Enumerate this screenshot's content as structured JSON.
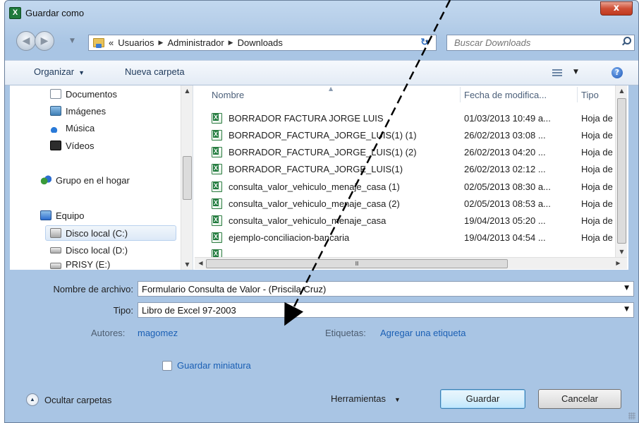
{
  "window": {
    "title": "Guardar como",
    "app_icon_letter": "X",
    "close_glyph": "x"
  },
  "navbar": {
    "crumb_prefix": "«",
    "breadcrumb": [
      "Usuarios",
      "Administrador",
      "Downloads"
    ],
    "search_placeholder": "Buscar Downloads"
  },
  "toolbar": {
    "organize_label": "Organizar",
    "new_folder_label": "Nueva carpeta",
    "help_glyph": "?"
  },
  "nav_pane": {
    "items": [
      {
        "label": "Documentos",
        "icon": "document-icon"
      },
      {
        "label": "Imágenes",
        "icon": "pictures-icon"
      },
      {
        "label": "Música",
        "icon": "music-icon"
      },
      {
        "label": "Vídeos",
        "icon": "video-icon"
      },
      {
        "label": "Grupo en el hogar",
        "icon": "homegroup-icon"
      },
      {
        "label": "Equipo",
        "icon": "computer-icon"
      },
      {
        "label": "Disco local (C:)",
        "icon": "drive-icon",
        "selected": true
      },
      {
        "label": "Disco local (D:)",
        "icon": "drive-icon"
      },
      {
        "label": "PRISY (E:)",
        "icon": "drive-icon"
      }
    ]
  },
  "file_list": {
    "columns": [
      "Nombre",
      "Fecha de modifica...",
      "Tipo"
    ],
    "rows": [
      {
        "name": "BORRADOR FACTURA JORGE LUIS",
        "date": "01/03/2013 10:49 a...",
        "type": "Hoja de c"
      },
      {
        "name": "BORRADOR_FACTURA_JORGE_LUIS(1) (1)",
        "date": "26/02/2013 03:08 ...",
        "type": "Hoja de c"
      },
      {
        "name": "BORRADOR_FACTURA_JORGE_LUIS(1) (2)",
        "date": "26/02/2013 04:20 ...",
        "type": "Hoja de c"
      },
      {
        "name": "BORRADOR_FACTURA_JORGE_LUIS(1)",
        "date": "26/02/2013 02:12 ...",
        "type": "Hoja de c"
      },
      {
        "name": "consulta_valor_vehiculo_menaje_casa (1)",
        "date": "02/05/2013 08:30 a...",
        "type": "Hoja de c"
      },
      {
        "name": "consulta_valor_vehiculo_menaje_casa (2)",
        "date": "02/05/2013 08:53 a...",
        "type": "Hoja de c"
      },
      {
        "name": "consulta_valor_vehiculo_menaje_casa",
        "date": "19/04/2013 05:20 ...",
        "type": "Hoja de c"
      },
      {
        "name": "ejemplo-conciliacion-bancaria",
        "date": "19/04/2013 04:54 ...",
        "type": "Hoja de c"
      }
    ]
  },
  "form": {
    "filename_label": "Nombre de archivo:",
    "filename_value": "Formulario Consulta de Valor - (Priscila Cruz)",
    "type_label": "Tipo:",
    "type_value": "Libro de Excel 97-2003",
    "authors_label": "Autores:",
    "authors_value": "magomez",
    "tags_label": "Etiquetas:",
    "tags_value": "Agregar una etiqueta",
    "thumbnail_label": "Guardar miniatura",
    "thumbnail_checked": false
  },
  "footer": {
    "hide_folders_label": "Ocultar carpetas",
    "tools_label": "Herramientas",
    "save_label": "Guardar",
    "cancel_label": "Cancelar"
  },
  "colors": {
    "link_blue": "#1a5fb4",
    "excel_green": "#1f7a3c",
    "close_red": "#cf4f36",
    "arrow": "#000000"
  }
}
